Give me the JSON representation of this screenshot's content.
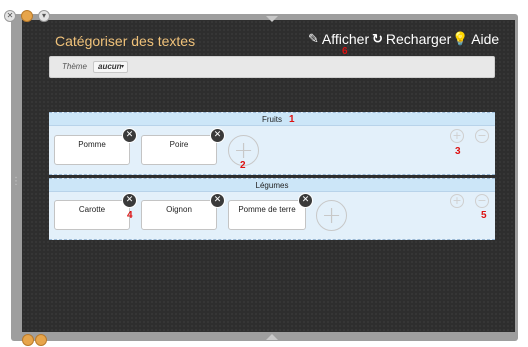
{
  "app": {
    "title": "Catégoriser des textes"
  },
  "toolbar": {
    "afficher": {
      "label": "Afficher",
      "icon": "pencil-icon"
    },
    "recharger": {
      "label": "Recharger",
      "icon": "reload-icon"
    },
    "aide": {
      "label": "Aide",
      "icon": "lightbulb-icon"
    }
  },
  "theme": {
    "label": "Thème",
    "value": "aucun"
  },
  "categories": [
    {
      "name": "Fruits",
      "items": [
        "Pomme",
        "Poire"
      ]
    },
    {
      "name": "Légumes",
      "items": [
        "Carotte",
        "Oignon",
        "Pomme de terre"
      ]
    }
  ],
  "annotations": {
    "afficher": "6",
    "fruits_header": "1",
    "fruits_add_card": "2",
    "fruits_add_category": "3",
    "legumes_card_close": "4",
    "legumes_remove_category": "5"
  },
  "glyphs": {
    "close": "✕",
    "add": "+",
    "remove": "−",
    "caret": "▾"
  },
  "colors": {
    "title": "#f0c27a",
    "header": "#cce6f8",
    "body": "#e3f0fa",
    "annotation": "#dd1111"
  }
}
